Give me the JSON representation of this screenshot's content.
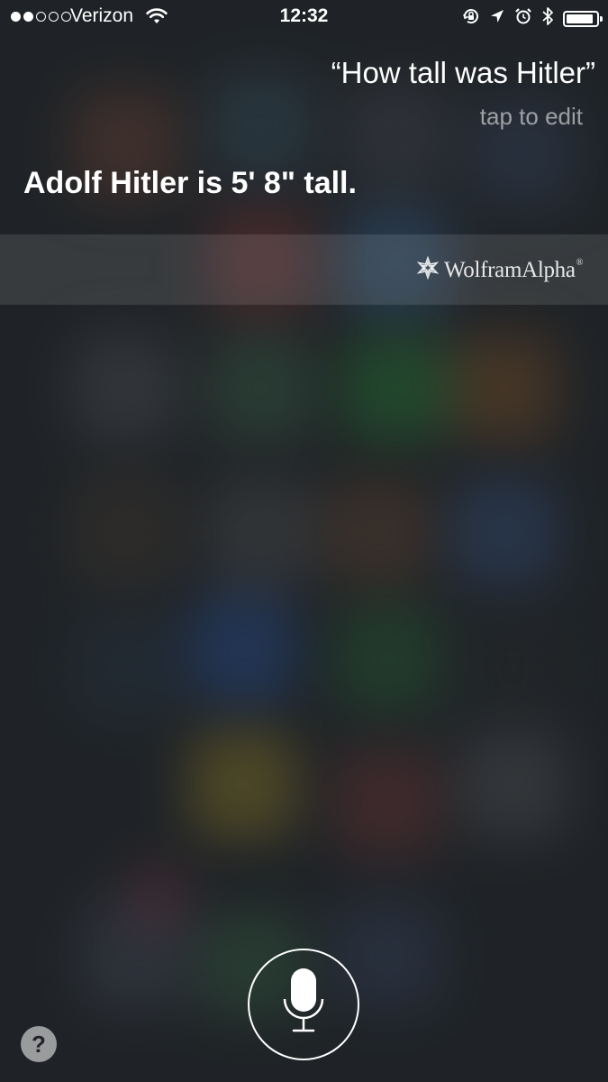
{
  "status_bar": {
    "signal_dots_filled": 2,
    "signal_dots_total": 5,
    "carrier": "Verizon",
    "time": "12:32",
    "battery_level_fraction": 0.9,
    "icons": [
      "wifi-icon",
      "orientation-lock-icon",
      "location-arrow-icon",
      "alarm-icon",
      "bluetooth-icon",
      "battery-icon"
    ]
  },
  "siri": {
    "query": "“How tall was Hitler”",
    "tap_to_edit": "tap to edit",
    "answer": "Adolf Hitler is 5' 8\" tall.",
    "source": {
      "name": "WolframAlpha",
      "registered_mark": "®",
      "icon": "wolfram-star-icon"
    }
  },
  "controls": {
    "mic_icon": "microphone-icon",
    "help_label": "?"
  },
  "colors": {
    "text": "#ffffff",
    "secondary_text": "#9a9ea3",
    "background": "#23272b"
  }
}
